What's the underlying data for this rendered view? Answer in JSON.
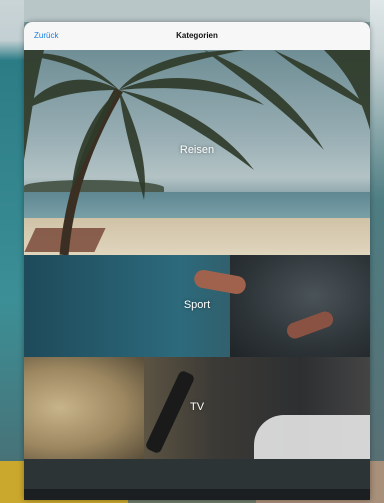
{
  "navbar": {
    "back_label": "Zurück",
    "title": "Kategorien"
  },
  "categories": [
    {
      "label": "Reisen",
      "image": "beach-palm"
    },
    {
      "label": "Sport",
      "image": "runner"
    },
    {
      "label": "TV",
      "image": "remote-control"
    },
    {
      "label": "",
      "image": "dark"
    }
  ],
  "colors": {
    "accent": "#1a7ee0",
    "navbar_bg": "#f7f7f7"
  }
}
